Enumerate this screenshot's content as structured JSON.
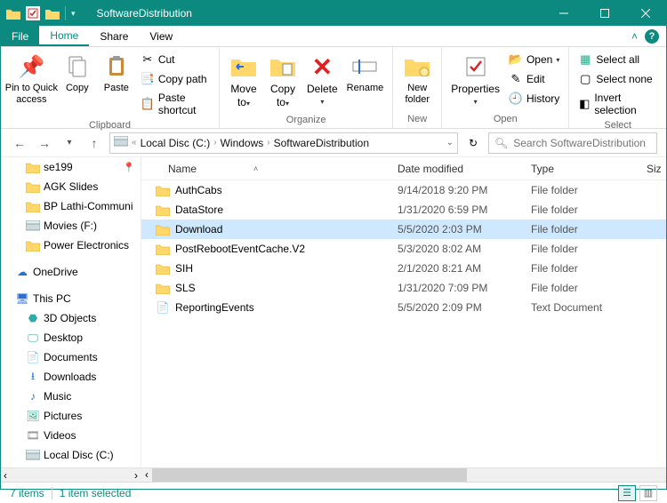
{
  "window": {
    "title": "SoftwareDistribution"
  },
  "tabs": {
    "file": "File",
    "home": "Home",
    "share": "Share",
    "view": "View"
  },
  "ribbon": {
    "pin": "Pin to Quick\naccess",
    "copy": "Copy",
    "paste": "Paste",
    "cut": "Cut",
    "copy_path": "Copy path",
    "paste_shortcut": "Paste shortcut",
    "move_to": "Move\nto",
    "copy_to": "Copy\nto",
    "delete": "Delete",
    "rename": "Rename",
    "new_folder": "New\nfolder",
    "properties": "Properties",
    "open": "Open",
    "edit": "Edit",
    "history": "History",
    "select_all": "Select all",
    "select_none": "Select none",
    "invert_selection": "Invert selection",
    "groups": {
      "clipboard": "Clipboard",
      "organize": "Organize",
      "new": "New",
      "open": "Open",
      "select": "Select"
    }
  },
  "breadcrumbs": [
    "Local Disc (C:)",
    "Windows",
    "SoftwareDistribution"
  ],
  "search": {
    "placeholder": "Search SoftwareDistribution"
  },
  "nav": [
    {
      "label": "se199",
      "icon": "folder",
      "depth": 1,
      "pinned": true
    },
    {
      "label": "AGK Slides",
      "icon": "folder",
      "depth": 1
    },
    {
      "label": "BP Lathi-Communi",
      "icon": "folder",
      "depth": 1
    },
    {
      "label": "Movies (F:)",
      "icon": "drive",
      "depth": 1
    },
    {
      "label": "Power Electronics",
      "icon": "folder",
      "depth": 1
    },
    {
      "spacer": true
    },
    {
      "label": "OneDrive",
      "icon": "cloud",
      "depth": 0
    },
    {
      "spacer": true
    },
    {
      "label": "This PC",
      "icon": "pc",
      "depth": 0
    },
    {
      "label": "3D Objects",
      "icon": "3d",
      "depth": 1
    },
    {
      "label": "Desktop",
      "icon": "desktop",
      "depth": 1
    },
    {
      "label": "Documents",
      "icon": "doc",
      "depth": 1
    },
    {
      "label": "Downloads",
      "icon": "down",
      "depth": 1
    },
    {
      "label": "Music",
      "icon": "music",
      "depth": 1
    },
    {
      "label": "Pictures",
      "icon": "pic",
      "depth": 1
    },
    {
      "label": "Videos",
      "icon": "video",
      "depth": 1
    },
    {
      "label": "Local Disc (C:)",
      "icon": "drive",
      "depth": 1
    }
  ],
  "columns": {
    "name": "Name",
    "date": "Date modified",
    "type": "Type",
    "size": "Siz"
  },
  "rows": [
    {
      "name": "AuthCabs",
      "date": "9/14/2018 9:20 PM",
      "type": "File folder",
      "icon": "folder"
    },
    {
      "name": "DataStore",
      "date": "1/31/2020 6:59 PM",
      "type": "File folder",
      "icon": "folder"
    },
    {
      "name": "Download",
      "date": "5/5/2020 2:03 PM",
      "type": "File folder",
      "icon": "folder",
      "selected": true
    },
    {
      "name": "PostRebootEventCache.V2",
      "date": "5/3/2020 8:02 AM",
      "type": "File folder",
      "icon": "folder"
    },
    {
      "name": "SIH",
      "date": "2/1/2020 8:21 AM",
      "type": "File folder",
      "icon": "folder"
    },
    {
      "name": "SLS",
      "date": "1/31/2020 7:09 PM",
      "type": "File folder",
      "icon": "folder"
    },
    {
      "name": "ReportingEvents",
      "date": "5/5/2020 2:09 PM",
      "type": "Text Document",
      "icon": "text"
    }
  ],
  "status": {
    "items": "7 items",
    "selected": "1 item selected"
  }
}
